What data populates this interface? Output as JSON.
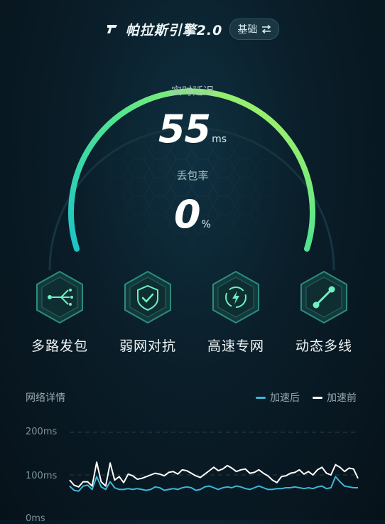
{
  "header": {
    "brand_title": "帕拉斯引擎2.0",
    "mode_label": "基础",
    "mode_icon": "swap-icon"
  },
  "gauge": {
    "latency_label": "实时延迟",
    "latency_value": "55",
    "latency_unit": "ms",
    "packet_loss_label": "丢包率",
    "packet_loss_value": "0",
    "packet_loss_unit": "%",
    "arc_colors": [
      "#1ec8c8",
      "#57e68a",
      "#b8f25a"
    ]
  },
  "features": [
    {
      "label": "多路发包",
      "icon": "multipath-icon"
    },
    {
      "label": "弱网对抗",
      "icon": "shield-check-icon"
    },
    {
      "label": "高速专网",
      "icon": "lightning-icon"
    },
    {
      "label": "动态多线",
      "icon": "link-nodes-icon"
    }
  ],
  "network_details": {
    "title": "网络详情",
    "legend": [
      {
        "label": "加速后",
        "color": "#3cb8d8"
      },
      {
        "label": "加速前",
        "color": "#ffffff"
      }
    ],
    "y_ticks": [
      "200ms",
      "100ms",
      "0ms"
    ]
  },
  "chart_data": {
    "type": "line",
    "ylim": [
      0,
      200
    ],
    "yticks": [
      "200ms",
      "100ms",
      "0ms"
    ],
    "series": [
      {
        "name": "加速前",
        "color": "#ffffff",
        "values": [
          88,
          76,
          72,
          84,
          84,
          74,
          130,
          84,
          74,
          128,
          88,
          96,
          82,
          102,
          98,
          90,
          92,
          96,
          100,
          104,
          102,
          98,
          106,
          108,
          102,
          112,
          110,
          104,
          98,
          94,
          102,
          110,
          118,
          110,
          114,
          122,
          116,
          108,
          112,
          114,
          104,
          106,
          112,
          104,
          98,
          88,
          82,
          96,
          98,
          104,
          106,
          112,
          102,
          108,
          100,
          112,
          118,
          104,
          100,
          124,
          118,
          108,
          116,
          114,
          92
        ]
      },
      {
        "name": "加速后",
        "color": "#3cb8d8",
        "values": [
          74,
          64,
          62,
          74,
          76,
          66,
          96,
          72,
          66,
          84,
          70,
          66,
          66,
          68,
          66,
          68,
          66,
          64,
          66,
          72,
          70,
          64,
          66,
          68,
          66,
          70,
          72,
          70,
          64,
          66,
          72,
          74,
          70,
          66,
          70,
          72,
          70,
          74,
          72,
          68,
          66,
          70,
          74,
          70,
          66,
          66,
          68,
          68,
          70,
          70,
          72,
          70,
          68,
          70,
          68,
          72,
          74,
          68,
          70,
          96,
          84,
          74,
          72,
          70,
          70
        ]
      }
    ]
  }
}
